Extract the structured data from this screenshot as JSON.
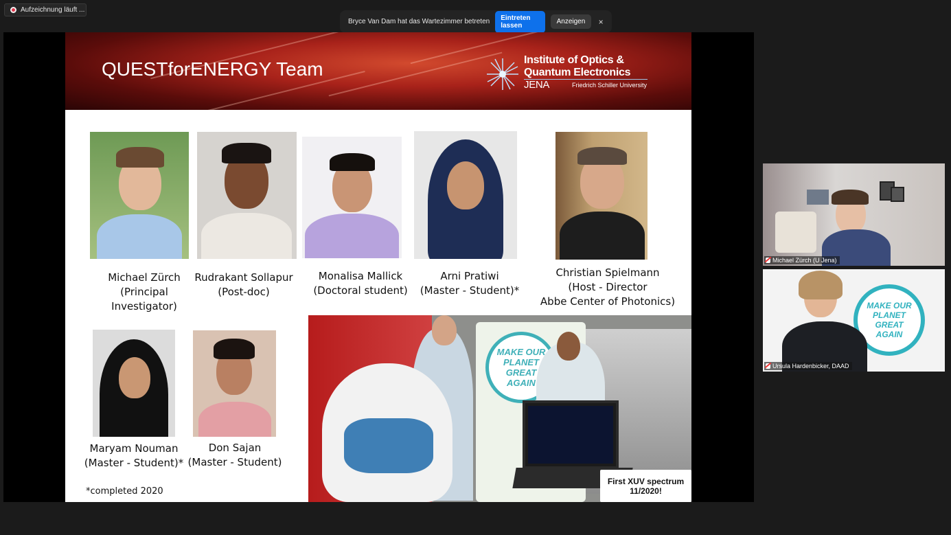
{
  "recording": {
    "label": "Aufzeichnung läuft ..."
  },
  "waiting_room": {
    "message": "Bryce Van Dam hat das Wartezimmer betreten",
    "admit_label": "Eintreten lassen",
    "view_label": "Anzeigen",
    "close_icon": "×"
  },
  "slide": {
    "title": "QUESTforENERGY Team",
    "logo": {
      "line1": "Institute of Optics &",
      "line2": "Quantum Electronics",
      "line2_suffix": "JENA",
      "line3": "Friedrich Schiller University"
    },
    "people": [
      {
        "name": "Michael Zürch",
        "role_lines": [
          "(Principal",
          "Investigator)"
        ]
      },
      {
        "name": "Rudrakant Sollapur",
        "role_lines": [
          "(Post-doc)"
        ]
      },
      {
        "name": "Monalisa Mallick",
        "role_lines": [
          "(Doctoral student)"
        ]
      },
      {
        "name": "Arni Pratiwi",
        "role_lines": [
          "(Master - Student)*"
        ]
      },
      {
        "name": "Christian Spielmann",
        "role_lines": [
          "(Host - Director",
          "Abbe Center of Photonics)"
        ]
      },
      {
        "name": "Maryam Nouman",
        "role_lines": [
          "(Master - Student)*"
        ]
      },
      {
        "name": "Don Sajan",
        "role_lines": [
          "(Master - Student)"
        ]
      }
    ],
    "footnote": "*completed 2020",
    "lab_photo": {
      "callout_line1": "First XUV spectrum",
      "callout_line2": "11/2020!",
      "poster_line1": "MAKE OUR",
      "poster_line2": "PLANET",
      "poster_line3": "GREAT",
      "poster_line4": "AGAIN"
    }
  },
  "participants": [
    {
      "name": "Michael Zürch (U Jena)"
    },
    {
      "name": "Ursula Hardenbicker, DAAD"
    }
  ],
  "colors": {
    "zoom_blue": "#0e71eb",
    "background": "#1b1b1b"
  }
}
